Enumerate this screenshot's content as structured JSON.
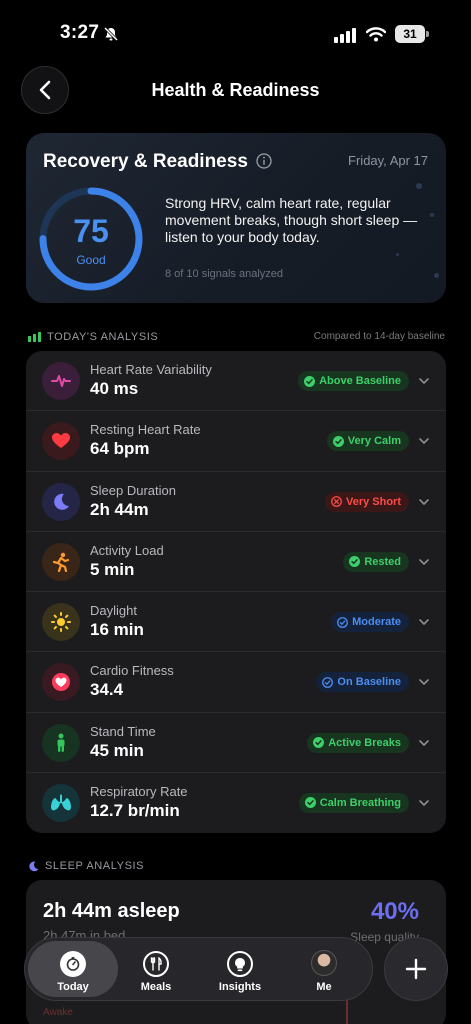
{
  "status_bar": {
    "time": "3:27",
    "battery": "31"
  },
  "header": {
    "title": "Health & Readiness"
  },
  "recovery": {
    "title": "Recovery & Readiness",
    "date": "Friday, Apr 17",
    "score": "75",
    "score_fraction": 0.75,
    "score_label": "Good",
    "summary": "Strong HRV, calm heart rate, regular movement breaks, though short sleep — listen to your body today.",
    "signals": "8 of 10 signals analyzed",
    "accent_color": "#4a90f0"
  },
  "analysis": {
    "heading": "TODAY'S ANALYSIS",
    "compare": "Compared to 14-day baseline",
    "metrics": [
      {
        "label": "Heart Rate Variability",
        "value": "40 ms",
        "badge": "Above Baseline",
        "status": "green",
        "icon": "heartbeat-wave-icon"
      },
      {
        "label": "Resting Heart Rate",
        "value": "64 bpm",
        "badge": "Very Calm",
        "status": "green",
        "icon": "heart-icon"
      },
      {
        "label": "Sleep Duration",
        "value": "2h 44m",
        "badge": "Very Short",
        "status": "red",
        "icon": "moon-icon"
      },
      {
        "label": "Activity Load",
        "value": "5 min",
        "badge": "Rested",
        "status": "green",
        "icon": "runner-icon"
      },
      {
        "label": "Daylight",
        "value": "16 min",
        "badge": "Moderate",
        "status": "blue",
        "icon": "sun-icon"
      },
      {
        "label": "Cardio Fitness",
        "value": "34.4",
        "badge": "On Baseline",
        "status": "blue",
        "icon": "heart-circle-icon"
      },
      {
        "label": "Stand Time",
        "value": "45 min",
        "badge": "Active Breaks",
        "status": "green",
        "icon": "standing-person-icon"
      },
      {
        "label": "Respiratory Rate",
        "value": "12.7 br/min",
        "badge": "Calm Breathing",
        "status": "green",
        "icon": "lungs-icon"
      }
    ]
  },
  "sleep": {
    "heading": "SLEEP ANALYSIS",
    "asleep": "2h 44m asleep",
    "in_bed": "2h 47m in bed",
    "quality_pct": "40%",
    "quality_label": "Sleep quality",
    "awake_label": "Awake"
  },
  "tabbar": {
    "tabs": [
      {
        "label": "Today",
        "icon": "timer-icon"
      },
      {
        "label": "Meals",
        "icon": "fork-knife-icon"
      },
      {
        "label": "Insights",
        "icon": "lightbulb-icon"
      },
      {
        "label": "Me",
        "icon": "avatar"
      }
    ],
    "fab_icon": "plus-icon"
  }
}
